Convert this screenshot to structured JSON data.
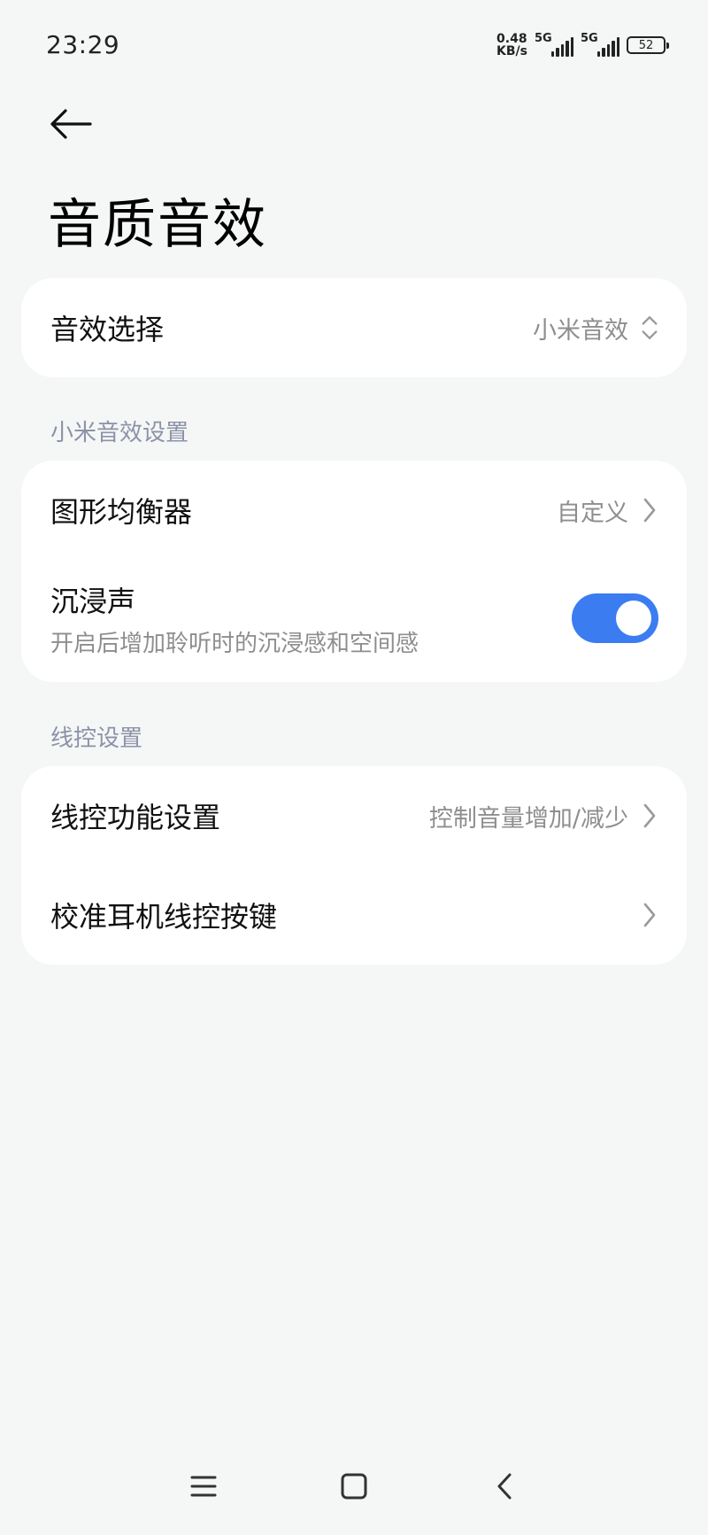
{
  "status_bar": {
    "time": "23:29",
    "net_speed_value": "0.48",
    "net_speed_unit": "KB/s",
    "sim1_label": "5G",
    "sim2_label": "5G",
    "battery": "52"
  },
  "header": {
    "title": "音质音效"
  },
  "effect_card": {
    "label": "音效选择",
    "value": "小米音效"
  },
  "xiaomi_section": {
    "header": "小米音效设置",
    "equalizer_label": "图形均衡器",
    "equalizer_value": "自定义",
    "immersive_label": "沉浸声",
    "immersive_desc": "开启后增加聆听时的沉浸感和空间感",
    "immersive_enabled": true
  },
  "wire_section": {
    "header": "线控设置",
    "function_label": "线控功能设置",
    "function_value": "控制音量增加/减少",
    "calibrate_label": "校准耳机线控按键"
  },
  "colors": {
    "accent": "#3b7cf1",
    "background": "#f5f6f6",
    "section_header": "#8c93a8"
  },
  "nav_icons": [
    "menu-icon",
    "home-icon",
    "back-icon"
  ]
}
